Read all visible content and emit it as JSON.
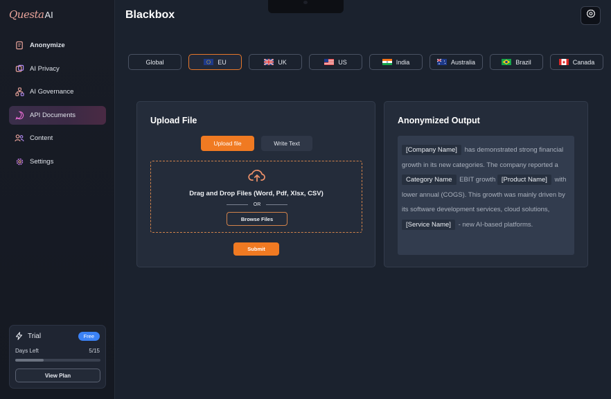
{
  "logo": {
    "script": "Questa",
    "suffix": "AI"
  },
  "sidebar": {
    "items": [
      {
        "label": "Anonymize",
        "icon": "document-edit-icon"
      },
      {
        "label": "AI Privacy",
        "icon": "privacy-icon"
      },
      {
        "label": "AI Governance",
        "icon": "hierarchy-icon"
      },
      {
        "label": "API Documents",
        "icon": "chat-bubble-icon"
      },
      {
        "label": "Content",
        "icon": "users-icon"
      },
      {
        "label": "Settings",
        "icon": "gear-icon"
      }
    ]
  },
  "trial": {
    "label": "Trial",
    "badge": "Free",
    "days_label": "Days Left",
    "days_value": "5/15",
    "progress": 0.33,
    "button": "View Plan"
  },
  "header": {
    "title": "Blackbox"
  },
  "regions": [
    "Global",
    "EU",
    "UK",
    "US",
    "India",
    "Australia",
    "Brazil",
    "Canada"
  ],
  "upload": {
    "title": "Upload File",
    "tab_upload": "Upload file",
    "tab_write": "Write Text",
    "drop_text": "Drag and Drop Files (Word, Pdf, Xlsx, CSV)",
    "or": "OR",
    "browse": "Browse Files",
    "submit": "Submit"
  },
  "output": {
    "title": "Anonymized Output",
    "tags": [
      "[Company Name]",
      "Category Name",
      "[Product Name]",
      "[Service Name]"
    ],
    "text": [
      "has demonstrated strong financial growth in its new  categories.   The company reported a",
      "EBIT growth",
      "with lower annual (COGS). This growth was mainly driven by its software development services, cloud solutions,",
      "- new AI-based platforms."
    ]
  },
  "colors": {
    "accent": "#f07a22",
    "badge": "#3b82f6",
    "background": "#1b222e",
    "panel": "#242c3a"
  }
}
